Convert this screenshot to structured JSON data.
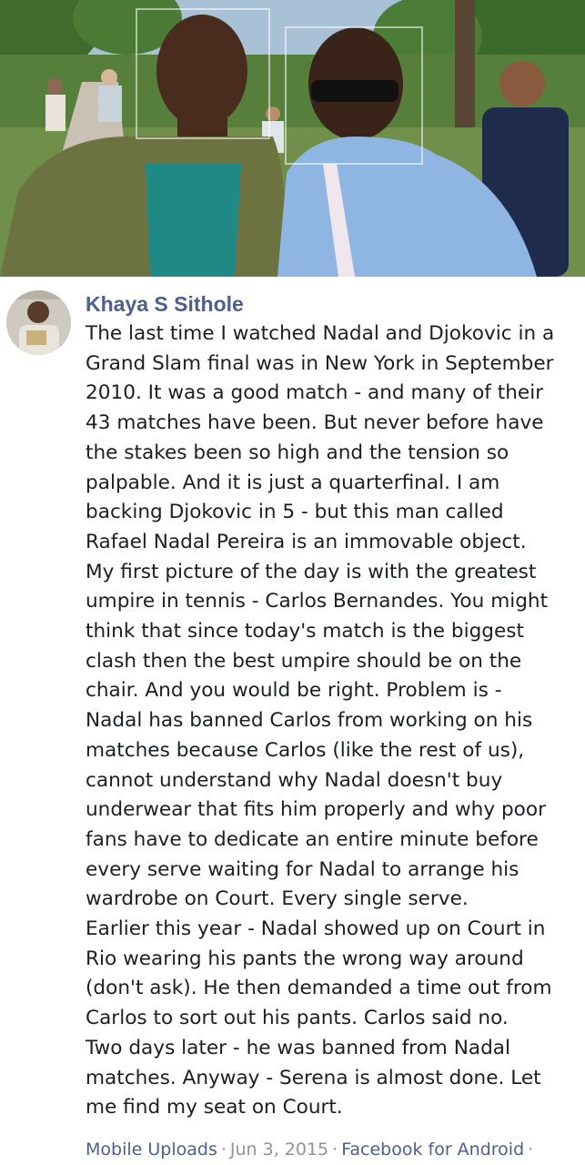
{
  "post": {
    "author": "Khaya S Sithole",
    "body_lines": [
      "The last time I watched Nadal and Djokovic in a",
      "Grand Slam final was in New York in September",
      "2010. It was a good match - and many of their",
      "43 matches have been. But never before have",
      "the stakes been so high and the tension so",
      "palpable. And it is just a quarterfinal. I am",
      "backing Djokovic in 5 - but this man called",
      "Rafael Nadal Pereira is an immovable object.",
      "My first picture of the day is with the greatest",
      "umpire in tennis - Carlos Bernandes. You might",
      "think that since today's match is the biggest",
      "clash then the best umpire should be on the",
      "chair. And you would be right. Problem is -",
      "Nadal has banned Carlos from working on his",
      "matches because Carlos (like the rest of us),",
      "cannot understand why Nadal doesn't buy",
      "underwear that fits him properly and why poor",
      "fans have to dedicate an entire minute before",
      "every serve waiting for Nadal to arrange his",
      "wardrobe on Court. Every single serve.",
      "Earlier this year - Nadal showed up on Court in",
      "Rio wearing his pants the wrong way around",
      "(don't ask). He then demanded a time out from",
      "Carlos to sort out his pants. Carlos said no.",
      "Two days later - he was banned from Nadal",
      "matches. Anyway - Serena is almost done. Let",
      "me find my seat on Court."
    ]
  },
  "footer": {
    "album": "Mobile Uploads",
    "separator": "·",
    "date": "Jun 3, 2015",
    "source": "Facebook for Android",
    "trailing": "·"
  },
  "colors": {
    "link": "#4d5f8c",
    "text": "#1c1e21",
    "meta": "#90949c"
  },
  "icons": {
    "photo": "photo-image",
    "avatar": "profile-avatar"
  }
}
